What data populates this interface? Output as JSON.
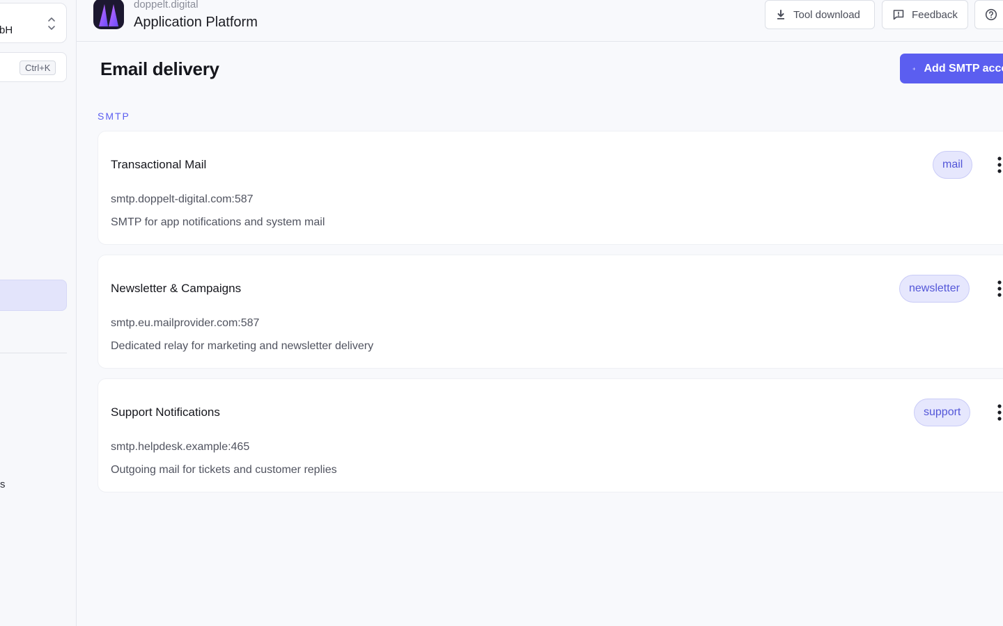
{
  "sidebar": {
    "org_name_fragment": "bH",
    "search_shortcut": "Ctrl+K",
    "item_fragment": "s"
  },
  "header": {
    "brand_small": "doppelt.digital",
    "brand_title": "Application Platform",
    "tool_download_label": "Tool download",
    "feedback_label": "Feedback"
  },
  "main": {
    "title": "Email delivery",
    "add_button_label": "Add SMTP account",
    "section_label": "SMTP",
    "accounts": [
      {
        "name": "Transactional Mail",
        "host": "smtp.doppelt-digital.com:587",
        "description": "SMTP for app notifications and system mail",
        "tag": "mail"
      },
      {
        "name": "Newsletter & Campaigns",
        "host": "smtp.eu.mailprovider.com:587",
        "description": "Dedicated relay for marketing and newsletter delivery",
        "tag": "newsletter"
      },
      {
        "name": "Support Notifications",
        "host": "smtp.helpdesk.example:465",
        "description": "Outgoing mail for tickets and customer replies",
        "tag": "support"
      }
    ]
  },
  "colors": {
    "accent": "#5b5ef0",
    "tag_bg": "#e6e7fd",
    "tag_text": "#5356d8",
    "background": "#f8f9fc"
  },
  "icons": {
    "org_switcher": "chevron-up-down-icon",
    "tool_download": "download-icon",
    "feedback": "message-square-icon",
    "help": "help-circle-icon",
    "add": "plus-icon",
    "card_menu": "more-vertical-icon"
  }
}
